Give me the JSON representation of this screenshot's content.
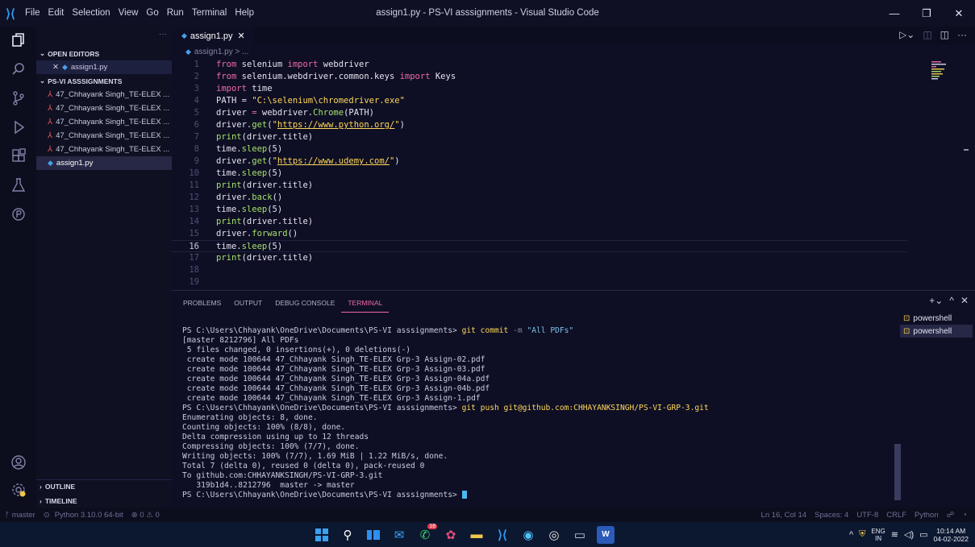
{
  "window": {
    "title": "assign1.py - PS-VI asssignments - Visual Studio Code"
  },
  "menu": [
    "File",
    "Edit",
    "Selection",
    "View",
    "Go",
    "Run",
    "Terminal",
    "Help"
  ],
  "sidebar": {
    "open_editors_label": "OPEN EDITORS",
    "open_editor_file": "assign1.py",
    "folder_label": "PS-VI ASSSIGNMENTS",
    "files": [
      "47_Chhayank Singh_TE-ELEX ...",
      "47_Chhayank Singh_TE-ELEX ...",
      "47_Chhayank Singh_TE-ELEX ...",
      "47_Chhayank Singh_TE-ELEX ...",
      "47_Chhayank Singh_TE-ELEX ...",
      "assign1.py"
    ],
    "outline_label": "OUTLINE",
    "timeline_label": "TIMELINE"
  },
  "editor": {
    "tab_label": "assign1.py",
    "breadcrumb": "assign1.py > ...",
    "current_line": 16
  },
  "code_lines": [
    "1",
    "2",
    "3",
    "4",
    "5",
    "6",
    "7",
    "8",
    "9",
    "10",
    "11",
    "12",
    "13",
    "14",
    "15",
    "16",
    "17",
    "18",
    "19"
  ],
  "panel": {
    "tabs": [
      "PROBLEMS",
      "OUTPUT",
      "DEBUG CONSOLE",
      "TERMINAL"
    ],
    "active_tab": "TERMINAL",
    "terminals": [
      "powershell",
      "powershell"
    ]
  },
  "terminal": {
    "prompt": "PS C:\\Users\\Chhayank\\OneDrive\\Documents\\PS-VI asssignments>",
    "cmd1": "git commit",
    "cmd1_flag": "-m",
    "cmd1_msg": "\"All PDFs\"",
    "out1": [
      "[master 8212796] All PDFs",
      " 5 files changed, 0 insertions(+), 0 deletions(-)",
      " create mode 100644 47_Chhayank Singh_TE-ELEX Grp-3 Assign-02.pdf",
      " create mode 100644 47_Chhayank Singh_TE-ELEX Grp-3 Assign-03.pdf",
      " create mode 100644 47_Chhayank Singh_TE-ELEX Grp-3 Assign-04a.pdf",
      " create mode 100644 47_Chhayank Singh_TE-ELEX Grp-3 Assign-04b.pdf",
      " create mode 100644 47_Chhayank Singh_TE-ELEX Grp-3 Assign-1.pdf"
    ],
    "cmd2": "git push git@github.com:CHHAYANKSINGH/PS-VI-GRP-3.git",
    "out2": [
      "Enumerating objects: 8, done.",
      "Counting objects: 100% (8/8), done.",
      "Delta compression using up to 12 threads",
      "Compressing objects: 100% (7/7), done.",
      "Writing objects: 100% (7/7), 1.69 MiB | 1.22 MiB/s, done.",
      "Total 7 (delta 0), reused 0 (delta 0), pack-reused 0",
      "To github.com:CHHAYANKSINGH/PS-VI-GRP-3.git",
      "   319b1d4..8212796  master -> master"
    ]
  },
  "status": {
    "branch": "master",
    "python": "Python 3.10.0 64-bit",
    "problems": "⊗ 0 ⚠ 0",
    "position": "Ln 16, Col 14",
    "spaces": "Spaces: 4",
    "encoding": "UTF-8",
    "eol": "CRLF",
    "language": "Python"
  },
  "taskbar": {
    "lang_top": "ENG",
    "lang_bottom": "IN",
    "time": "10:14 AM",
    "date": "04-02-2022",
    "whatsapp_badge": "18"
  },
  "colors": {
    "accent": "#f06aa8",
    "keyword": "#f06aa8",
    "function": "#a6e06a",
    "string": "#ffd75a"
  }
}
